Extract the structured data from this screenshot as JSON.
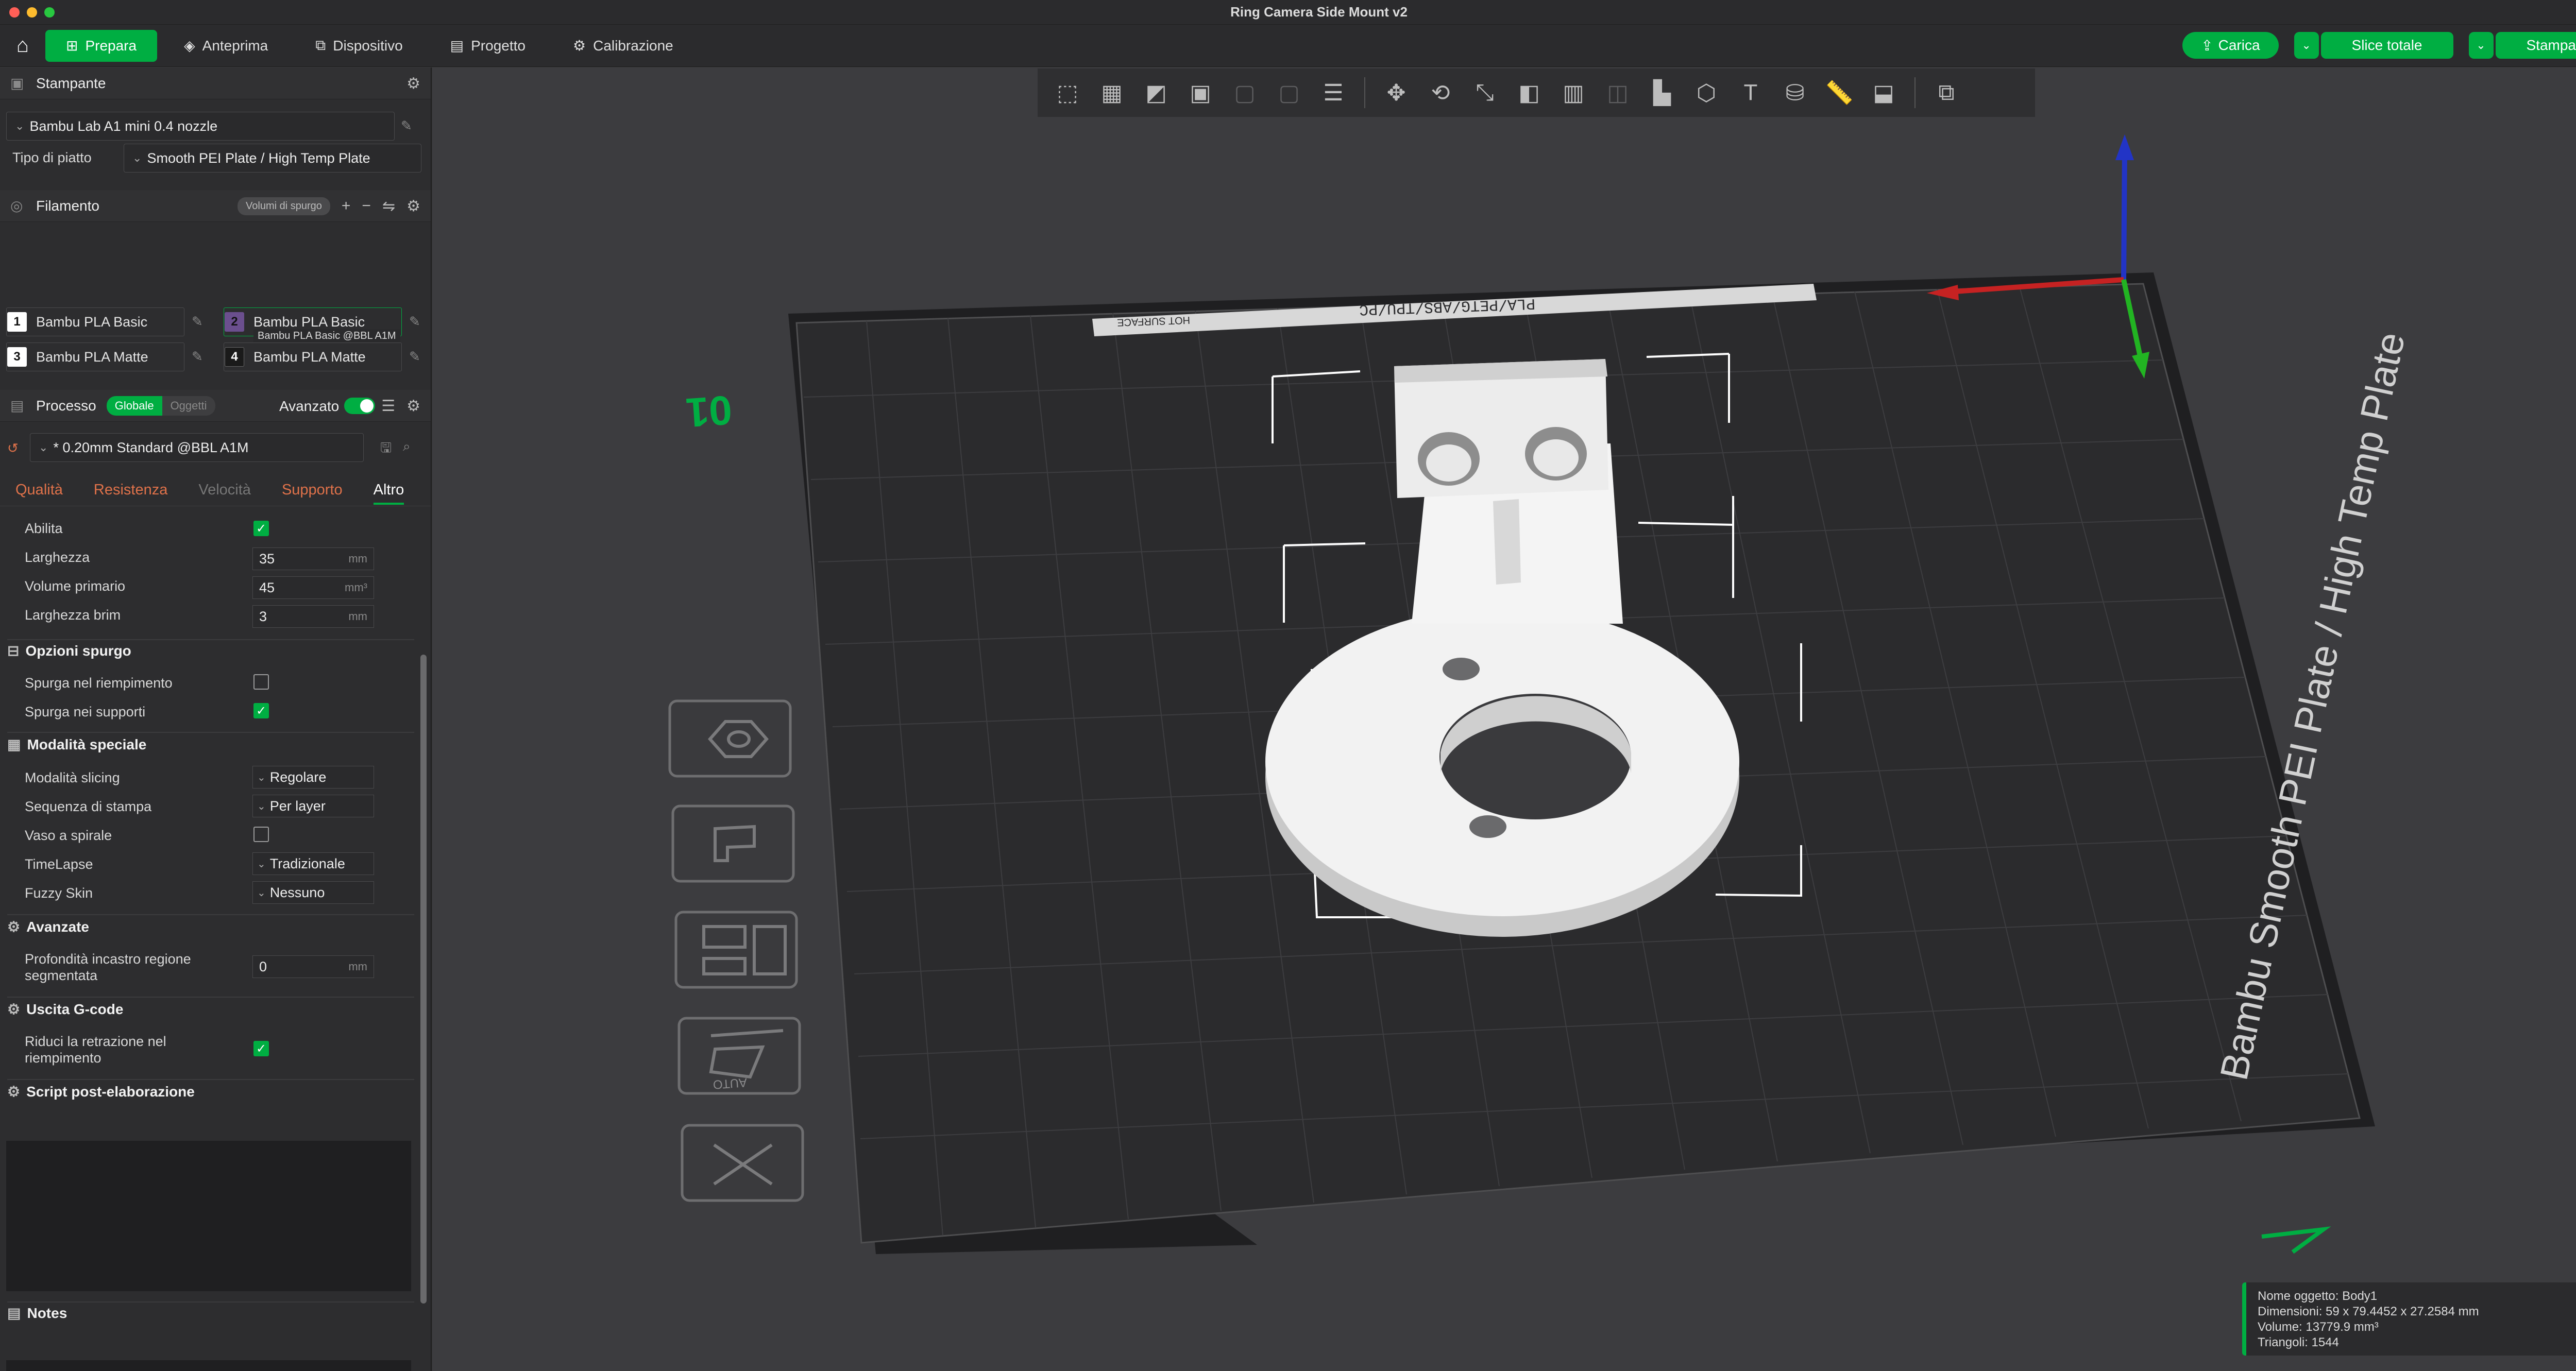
{
  "window": {
    "title": "Ring Camera Side Mount v2"
  },
  "top_tabs": [
    {
      "label": "Prepara",
      "icon": "cube-plus-icon"
    },
    {
      "label": "Anteprima",
      "icon": "layers-icon"
    },
    {
      "label": "Dispositivo",
      "icon": "device-icon"
    },
    {
      "label": "Progetto",
      "icon": "project-icon"
    },
    {
      "label": "Calibrazione",
      "icon": "calibration-icon"
    }
  ],
  "actions": {
    "load": "Carica",
    "slice": "Slice totale",
    "print": "Stampa"
  },
  "printer": {
    "header": "Stampante",
    "name": "Bambu Lab A1 mini 0.4 nozzle",
    "plate_label": "Tipo di piatto",
    "plate_value": "Smooth PEI Plate / High Temp Plate"
  },
  "filament": {
    "header": "Filamento",
    "purge_pill": "Volumi di spurgo",
    "slots": [
      {
        "num": "1",
        "name": "Bambu PLA Basic",
        "color": "#ffffff"
      },
      {
        "num": "2",
        "name": "Bambu PLA Basic",
        "color": "#6b4f8e",
        "tooltip": "Bambu PLA Basic @BBL A1M"
      },
      {
        "num": "3",
        "name": "Bambu PLA Matte",
        "color": "#ffffff"
      },
      {
        "num": "4",
        "name": "Bambu PLA Matte",
        "color": "#1a1a1a"
      }
    ]
  },
  "process": {
    "header": "Processo",
    "seg_global": "Globale",
    "seg_objects": "Oggetti",
    "advanced_label": "Avanzato",
    "profile": "* 0.20mm Standard @BBL A1M",
    "tabs": [
      "Qualità",
      "Resistenza",
      "Velocità",
      "Supporto",
      "Altro"
    ]
  },
  "params": {
    "enable": "Abilita",
    "width": {
      "label": "Larghezza",
      "value": "35",
      "unit": "mm"
    },
    "prime_volume": {
      "label": "Volume primario",
      "value": "45",
      "unit": "mm³"
    },
    "brim_width": {
      "label": "Larghezza brim",
      "value": "3",
      "unit": "mm"
    },
    "purge_group": "Opzioni spurgo",
    "purge_infill": "Spurga nel riempimento",
    "purge_support": "Spurga nei supporti",
    "special_group": "Modalità speciale",
    "slicing_mode": {
      "label": "Modalità slicing",
      "value": "Regolare"
    },
    "print_seq": {
      "label": "Sequenza di stampa",
      "value": "Per layer"
    },
    "spiral_vase": "Vaso a spirale",
    "timelapse": {
      "label": "TimeLapse",
      "value": "Tradizionale"
    },
    "fuzzy_skin": {
      "label": "Fuzzy Skin",
      "value": "Nessuno"
    },
    "advanced_group": "Avanzate",
    "segmented_depth": {
      "label_1": "Profondità incastro regione",
      "label_2": "segmentata",
      "value": "0",
      "unit": "mm"
    },
    "gcode_group": "Uscita G-code",
    "reduce_retract": {
      "label_1": "Riduci la retrazione nel",
      "label_2": "riempimento"
    },
    "post_script_group": "Script post-elaborazione",
    "notes_group": "Notes"
  },
  "plate": {
    "top_label": "PLA/PETG/ABS/TPU/PC",
    "hot_surface": "HOT SURFACE",
    "side_text": "Bambu Smooth PEI Plate / High Temp Plate",
    "badge": "01"
  },
  "object_info": {
    "name": "Nome oggetto: Body1",
    "dimensions": "Dimensioni: 59 x 79.4452 x 27.2584 mm",
    "volume": "Volume: 13779.9 mm³",
    "triangles": "Triangoli: 1544"
  },
  "colors": {
    "accent": "#00ae42",
    "warn_tab": "#e0724a"
  }
}
